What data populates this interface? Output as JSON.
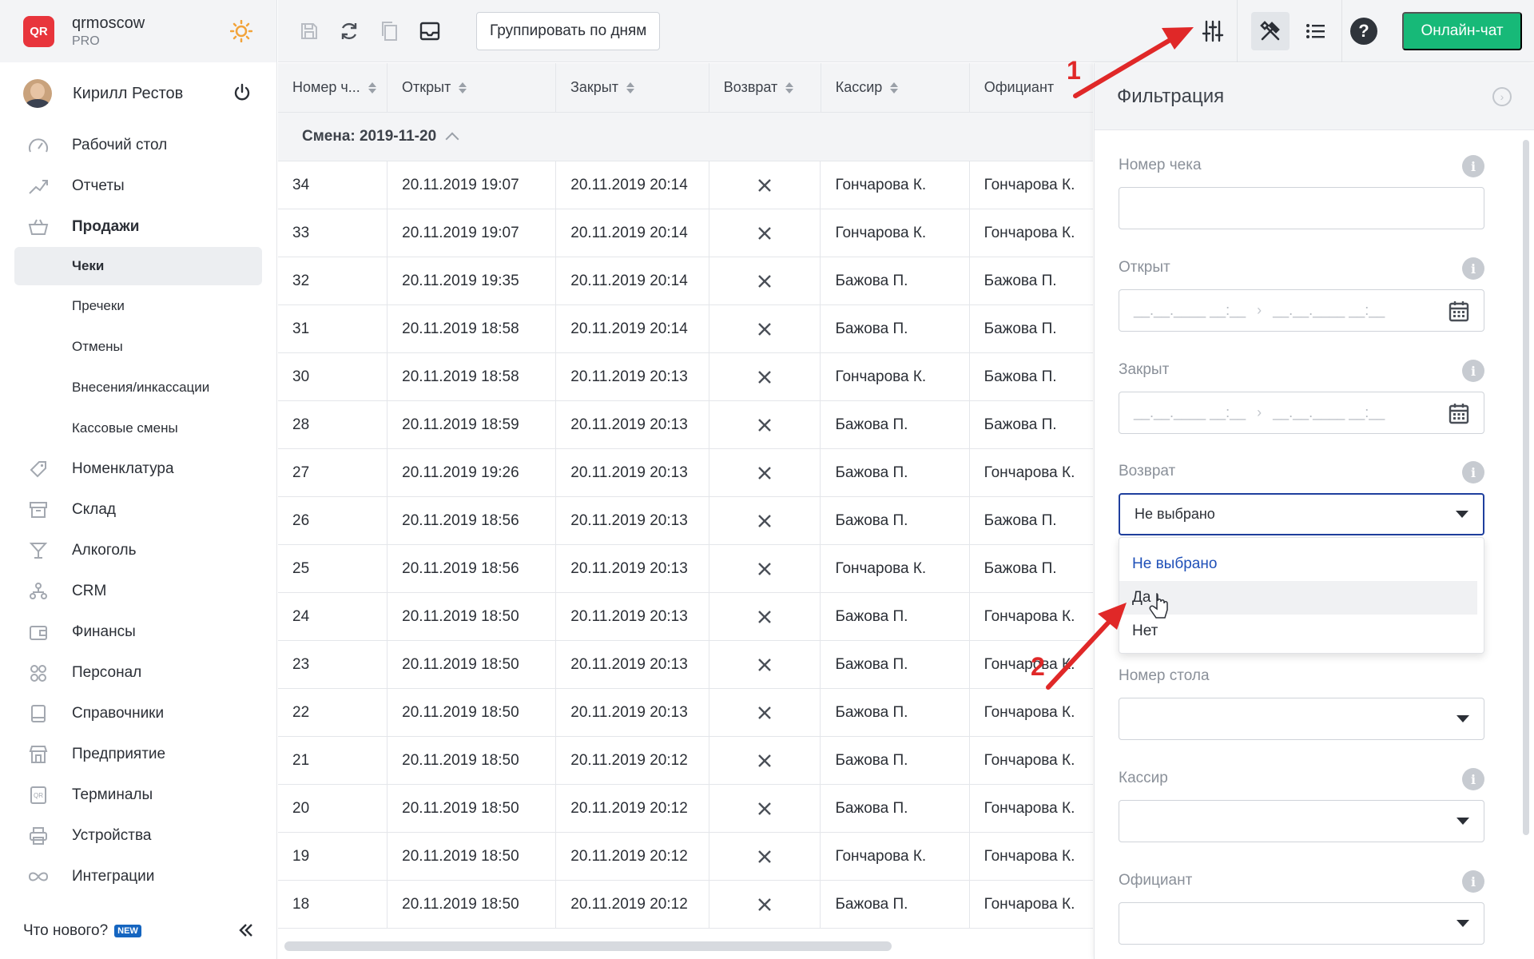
{
  "brand": {
    "logo": "QR",
    "name": "qrmoscow",
    "plan": "PRO"
  },
  "user": {
    "name": "Кирилл Рестов"
  },
  "nav": {
    "items": [
      {
        "label": "Рабочий стол",
        "icon": "dashboard-icon"
      },
      {
        "label": "Отчеты",
        "icon": "chart-icon"
      },
      {
        "label": "Продажи",
        "icon": "basket-icon"
      }
    ],
    "sales_sub": [
      "Чеки",
      "Пречеки",
      "Отмены",
      "Внесения/инкассации",
      "Кассовые смены"
    ],
    "items2": [
      {
        "label": "Номенклатура",
        "icon": "tag-icon"
      },
      {
        "label": "Склад",
        "icon": "box-icon"
      },
      {
        "label": "Алкоголь",
        "icon": "glass-icon"
      },
      {
        "label": "CRM",
        "icon": "people-tree-icon"
      },
      {
        "label": "Финансы",
        "icon": "wallet-icon"
      },
      {
        "label": "Персонал",
        "icon": "staff-icon"
      },
      {
        "label": "Справочники",
        "icon": "book-icon"
      },
      {
        "label": "Предприятие",
        "icon": "store-icon"
      },
      {
        "label": "Терминалы",
        "icon": "qr-terminal-icon"
      },
      {
        "label": "Устройства",
        "icon": "printer-icon"
      },
      {
        "label": "Интеграции",
        "icon": "infinity-icon"
      }
    ],
    "whats_new": "Что нового?",
    "new_badge": "NEW"
  },
  "toolbar": {
    "group_by_days": "Группировать по дням",
    "online_chat": "Онлайн-чат",
    "help": "?"
  },
  "table": {
    "headers": [
      "Номер ч...",
      "Открыт",
      "Закрыт",
      "Возврат",
      "Кассир",
      "Официант"
    ],
    "group_label": "Смена: 2019-11-20",
    "rows": [
      [
        "34",
        "20.11.2019 19:07",
        "20.11.2019 20:14",
        "Гончарова К.",
        "Гончарова К."
      ],
      [
        "33",
        "20.11.2019 19:07",
        "20.11.2019 20:14",
        "Гончарова К.",
        "Гончарова К."
      ],
      [
        "32",
        "20.11.2019 19:35",
        "20.11.2019 20:14",
        "Бажова П.",
        "Бажова П."
      ],
      [
        "31",
        "20.11.2019 18:58",
        "20.11.2019 20:14",
        "Бажова П.",
        "Бажова П."
      ],
      [
        "30",
        "20.11.2019 18:58",
        "20.11.2019 20:13",
        "Гончарова К.",
        "Бажова П."
      ],
      [
        "28",
        "20.11.2019 18:59",
        "20.11.2019 20:13",
        "Бажова П.",
        "Бажова П."
      ],
      [
        "27",
        "20.11.2019 19:26",
        "20.11.2019 20:13",
        "Бажова П.",
        "Гончарова К."
      ],
      [
        "26",
        "20.11.2019 18:56",
        "20.11.2019 20:13",
        "Бажова П.",
        "Бажова П."
      ],
      [
        "25",
        "20.11.2019 18:56",
        "20.11.2019 20:13",
        "Гончарова К.",
        "Бажова П."
      ],
      [
        "24",
        "20.11.2019 18:50",
        "20.11.2019 20:13",
        "Бажова П.",
        "Гончарова К."
      ],
      [
        "23",
        "20.11.2019 18:50",
        "20.11.2019 20:13",
        "Бажова П.",
        "Гончарова К."
      ],
      [
        "22",
        "20.11.2019 18:50",
        "20.11.2019 20:13",
        "Бажова П.",
        "Гончарова К."
      ],
      [
        "21",
        "20.11.2019 18:50",
        "20.11.2019 20:12",
        "Бажова П.",
        "Гончарова К."
      ],
      [
        "20",
        "20.11.2019 18:50",
        "20.11.2019 20:12",
        "Бажова П.",
        "Гончарова К."
      ],
      [
        "19",
        "20.11.2019 18:50",
        "20.11.2019 20:12",
        "Гончарова К.",
        "Гончарова К."
      ],
      [
        "18",
        "20.11.2019 18:50",
        "20.11.2019 20:12",
        "Бажова П.",
        "Гончарова К."
      ]
    ]
  },
  "filter": {
    "title": "Фильтрация",
    "check_number": {
      "label": "Номер чека",
      "value": ""
    },
    "opened": {
      "label": "Открыт",
      "from_placeholder": "__.__.____ __:__",
      "to_placeholder": "__.__.____ __:__"
    },
    "closed": {
      "label": "Закрыт",
      "from_placeholder": "__.__.____ __:__",
      "to_placeholder": "__.__.____ __:__"
    },
    "return": {
      "label": "Возврат",
      "value": "Не выбрано",
      "options": [
        "Не выбрано",
        "Да",
        "Нет"
      ]
    },
    "table_number": {
      "label": "Номер стола",
      "value": ""
    },
    "cashier": {
      "label": "Кассир",
      "value": ""
    },
    "waiter": {
      "label": "Официант",
      "value": ""
    }
  },
  "annotations": {
    "step1": "1",
    "step2": "2"
  },
  "colors": {
    "accent": "#17b978",
    "brand_red": "#e8353c",
    "focus_blue": "#1f3f9e",
    "arrow_red": "#e02828"
  }
}
